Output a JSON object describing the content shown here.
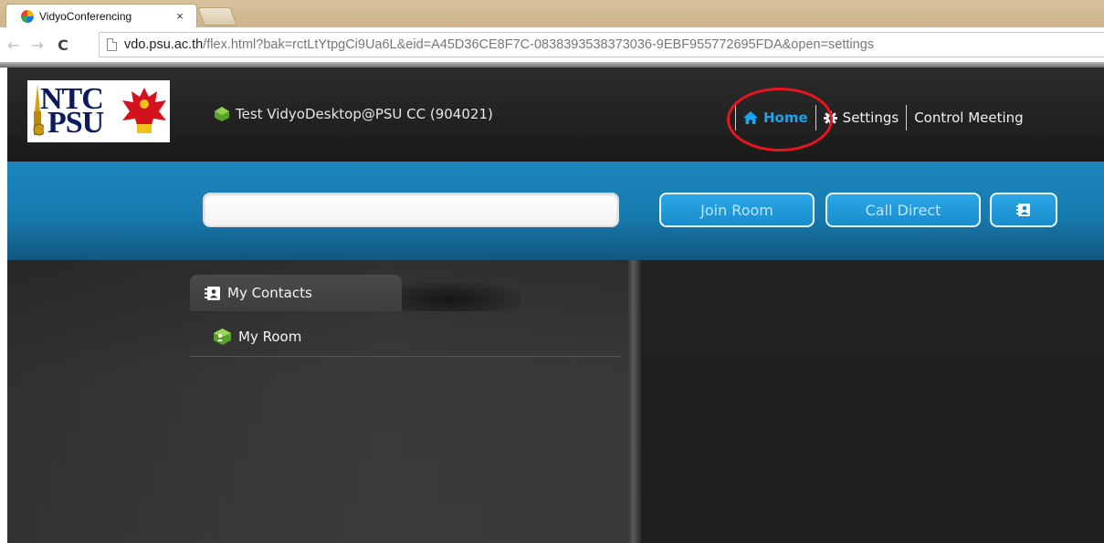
{
  "browser": {
    "tab_title": "VidyoConferencing",
    "tab_close": "×",
    "url_host": "vdo.psu.ac.th",
    "url_rest": "/flex.html?bak=rctLtYtpgCi9Ua6L&eid=A45D36CE8F7C-0838393538373036-9EBF955772695FDA&open=settings",
    "back": "←",
    "forward": "→",
    "reload": "C"
  },
  "app": {
    "logo": {
      "line1": "NTC",
      "line2": "PSU"
    },
    "user_name": "Test VidyoDesktop@PSU CC (904021)",
    "nav": {
      "home": "Home",
      "settings": "Settings",
      "control_meeting": "Control Meeting"
    },
    "search": {
      "value": "",
      "placeholder": ""
    },
    "buttons": {
      "join_room": "Join Room",
      "call_direct": "Call Direct"
    },
    "sidebar": {
      "my_contacts": "My Contacts",
      "my_room": "My Room"
    },
    "colors": {
      "accent_blue": "#1aa3ee",
      "band_blue": "#1b86bd",
      "highlight_red": "#e8141e",
      "header_dark": "#1e1e1e"
    }
  }
}
